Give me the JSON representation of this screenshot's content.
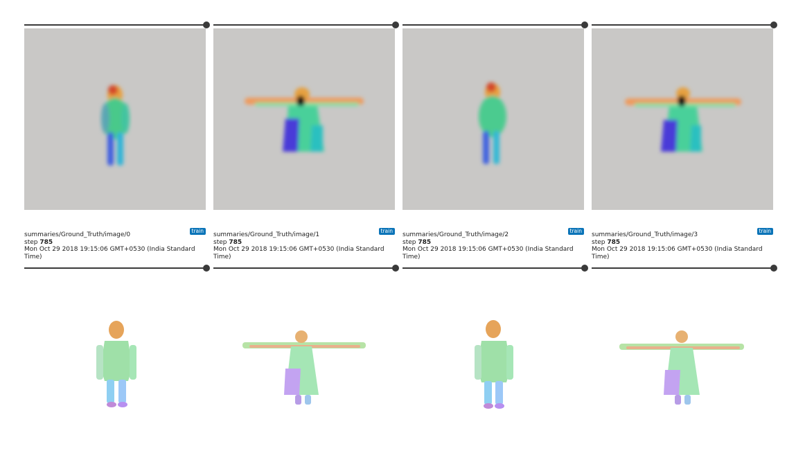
{
  "cards": [
    {
      "tag": "train",
      "run_name": "summaries/Ground_Truth/image/0",
      "step_label": "step",
      "step_value": "785",
      "timestamp": "Mon Oct 29 2018 19:15:06 GMT+0530 (India Standard Time)"
    },
    {
      "tag": "train",
      "run_name": "summaries/Ground_Truth/image/1",
      "step_label": "step",
      "step_value": "785",
      "timestamp": "Mon Oct 29 2018 19:15:06 GMT+0530 (India Standard Time)"
    },
    {
      "tag": "train",
      "run_name": "summaries/Ground_Truth/image/2",
      "step_label": "step",
      "step_value": "785",
      "timestamp": "Mon Oct 29 2018 19:15:06 GMT+0530 (India Standard Time)"
    },
    {
      "tag": "train",
      "run_name": "summaries/Ground_Truth/image/3",
      "step_label": "step",
      "step_value": "785",
      "timestamp": "Mon Oct 29 2018 19:15:06 GMT+0530 (India Standard Time)"
    }
  ],
  "colors": {
    "tag_bg": "#0b74b8",
    "image_bg": "#c9c8c6",
    "slider": "#3a3a3a"
  }
}
